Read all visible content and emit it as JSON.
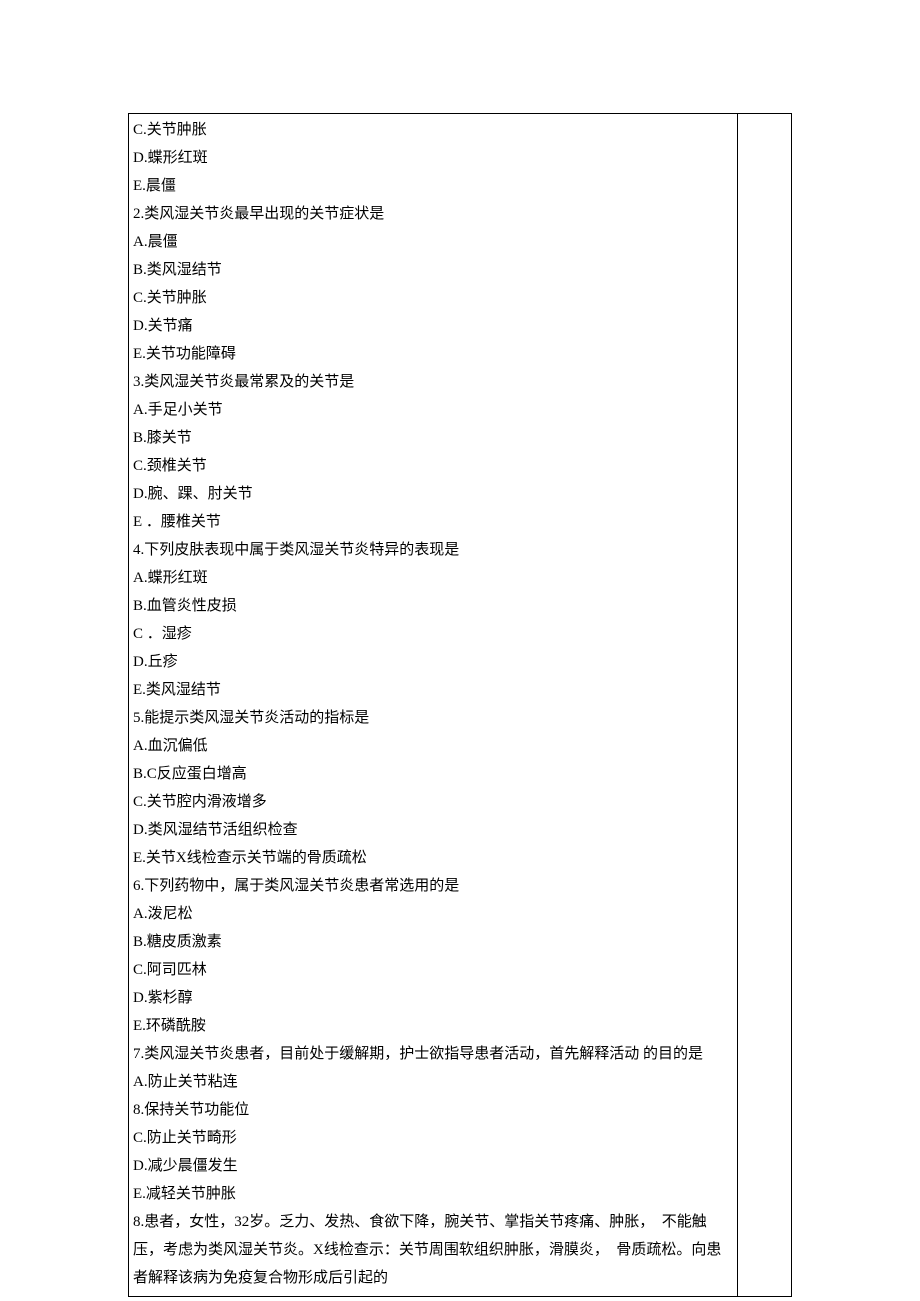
{
  "lines": [
    "C.关节肿胀",
    "D.蝶形红斑",
    "E.晨僵",
    "2.类风湿关节炎最早出现的关节症状是",
    "A.晨僵",
    "B.类风湿结节",
    "C.关节肿胀",
    "D.关节痛",
    "E.关节功能障碍",
    "3.类风湿关节炎最常累及的关节是",
    "A.手足小关节",
    "B.膝关节",
    "C.颈椎关节",
    "D.腕、踝、肘关节",
    "E ．腰椎关节",
    "4.下列皮肤表现中属于类风湿关节炎特异的表现是",
    "A.蝶形红斑",
    "B.血管炎性皮损",
    "C ．湿疹",
    "D.丘疹",
    "E.类风湿结节",
    "5.能提示类风湿关节炎活动的指标是",
    "A.血沉偏低",
    "B.C反应蛋白增高",
    "C.关节腔内滑液增多",
    "D.类风湿结节活组织检查",
    "E.关节X线检查示关节端的骨质疏松",
    "6.下列药物中，属于类风湿关节炎患者常选用的是",
    "A.泼尼松",
    "B.糖皮质激素",
    "C.阿司匹林",
    "D.紫杉醇",
    "E.环磷酰胺",
    "7.类风湿关节炎患者，目前处于缓解期，护士欲指导患者活动，首先解释活动 的目的是",
    "A.防止关节粘连",
    "8.保持关节功能位",
    "C.防止关节畸形",
    "D.减少晨僵发生",
    "E.减轻关节肿胀",
    "8.患者，女性，32岁。乏力、发热、食欲下降，腕关节、掌指关节疼痛、肿胀，  不能触压，考虑为类风湿关节炎。X线检查示：关节周围软组织肿胀，滑膜炎，  骨质疏松。向患者解释该病为免疫复合物形成后引起的"
  ]
}
